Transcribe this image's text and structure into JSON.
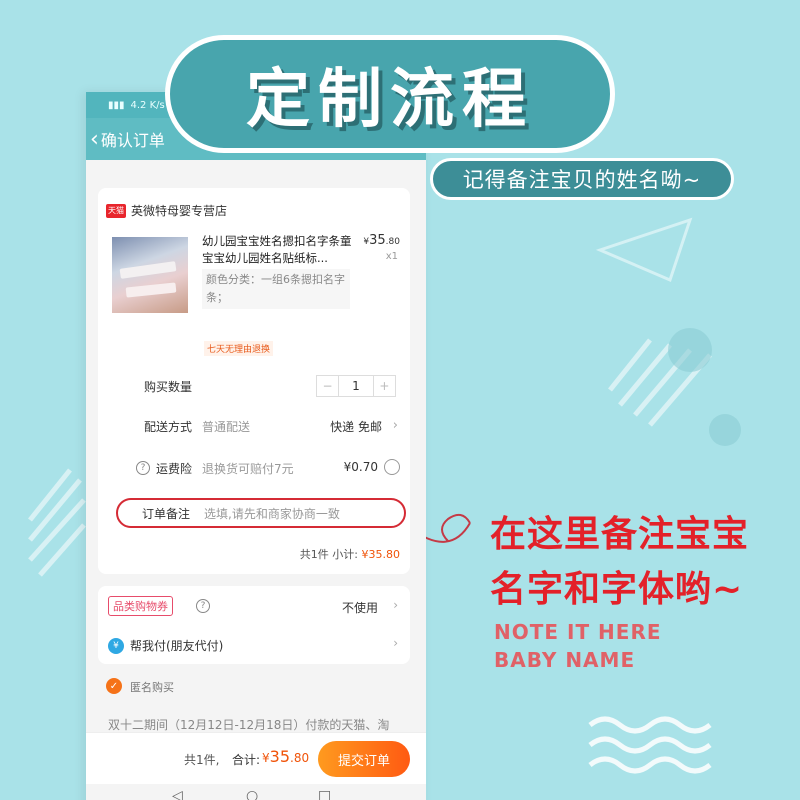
{
  "banner": {
    "title": "定制流程",
    "subtitle": "记得备注宝贝的姓名呦~"
  },
  "status_bar": {
    "text": "4.2 K/s"
  },
  "nav": {
    "back_glyph": "‹",
    "title": "确认订单"
  },
  "shop": {
    "badge": "天猫",
    "name": "英微特母婴专营店"
  },
  "product": {
    "title": "幼儿园宝宝姓名摁扣名字条童宝宝幼儿园姓名贴纸标...",
    "price_symbol": "¥",
    "price_int": "35",
    "price_dec": ".80",
    "qty": "x1",
    "sku": "颜色分类：一组6条摁扣名字条；",
    "tag": "七天无理由退换"
  },
  "quantity": {
    "label": "购买数量",
    "minus": "−",
    "value": "1",
    "plus": "+"
  },
  "delivery": {
    "label": "配送方式",
    "value": "普通配送",
    "right": "快递 免邮"
  },
  "insurance": {
    "label": "运费险",
    "value": "退换货可赔付7元",
    "right": "¥0.70"
  },
  "note": {
    "label": "订单备注",
    "placeholder": "选填,请先和商家协商一致"
  },
  "subtotal": {
    "count": "共1件",
    "label": "小计:",
    "amount": "¥35.80"
  },
  "coupon": {
    "badge": "品类购物券",
    "right": "不使用"
  },
  "friend_pay": {
    "icon": "¥",
    "label": "帮我付(朋友代付)"
  },
  "anonymous": {
    "label": "匿名购买"
  },
  "promo": {
    "text": "双十二期间（12月12日-12月18日）付款的天猫、淘"
  },
  "bottom": {
    "count": "共1件,",
    "total_label": "合计:",
    "total_symbol": "¥",
    "total_int": "35",
    "total_dec": ".80",
    "submit": "提交订单"
  },
  "system_nav": {
    "back": "◁",
    "home": "○",
    "recent": "□"
  },
  "callout": {
    "line1": "在这里备注宝宝",
    "line2": "名字和字体哟~",
    "en_line1": "NOTE IT HERE",
    "en_line2": "BABY NAME"
  },
  "colors": {
    "background": "#a9e2e8",
    "badge": "#48a5ad",
    "accent_red": "#e32129",
    "price_orange": "#f0540a",
    "nav_teal": "#5fbcc3"
  }
}
